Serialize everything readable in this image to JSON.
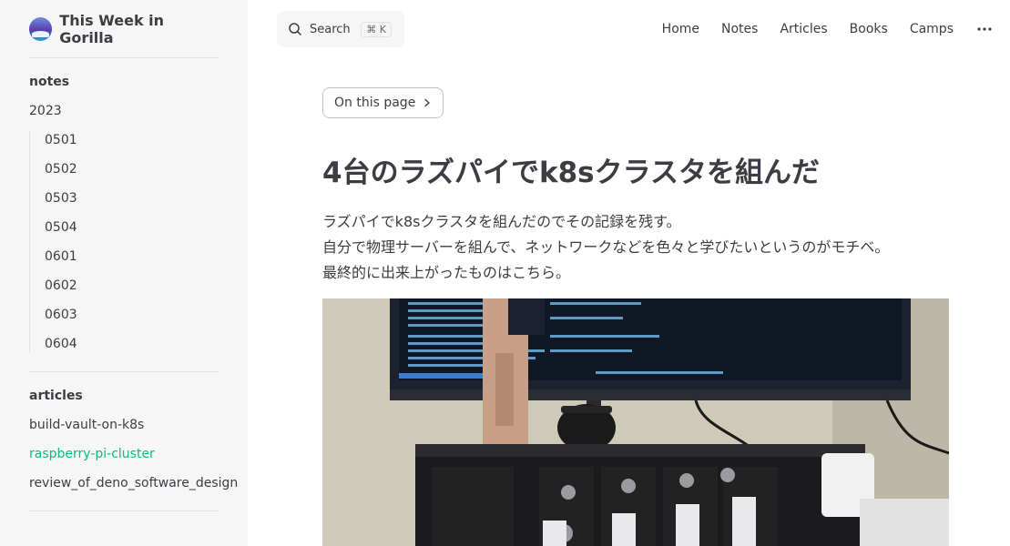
{
  "site": {
    "title": "This Week in Gorilla"
  },
  "sidebar": {
    "notes": {
      "title": "notes",
      "group": "2023",
      "items": [
        "0501",
        "0502",
        "0503",
        "0504",
        "0601",
        "0602",
        "0603",
        "0604"
      ]
    },
    "articles": {
      "title": "articles",
      "items": [
        {
          "label": "build-vault-on-k8s",
          "active": false
        },
        {
          "label": "raspberry-pi-cluster",
          "active": true
        },
        {
          "label": "review_of_deno_software_design",
          "active": false
        }
      ]
    }
  },
  "search": {
    "label": "Search",
    "shortcut": "⌘ K"
  },
  "nav": {
    "items": [
      "Home",
      "Notes",
      "Articles",
      "Books",
      "Camps"
    ]
  },
  "content": {
    "on_this_page": "On this page",
    "title": "4台のラズパイでk8sクラスタを組んだ",
    "paragraphs": [
      "ラズパイでk8sクラスタを組んだのでその記録を残す。",
      "自分で物理サーバーを組んで、ネットワークなどを色々と学びたいというのがモチベ。",
      "最終的に出来上がったものはこちら。"
    ]
  },
  "colors": {
    "accent": "#10b981",
    "sidebar_bg": "#f6f6f7",
    "text": "#3c3c43"
  }
}
